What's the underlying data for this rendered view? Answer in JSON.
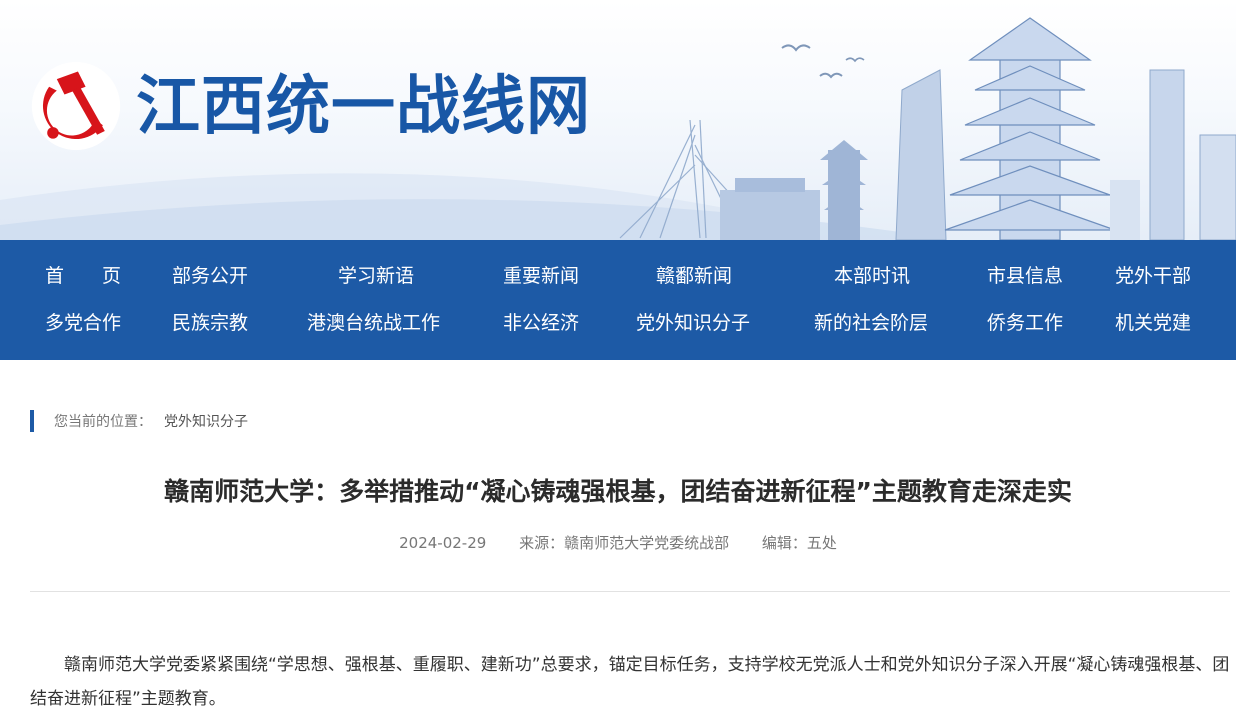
{
  "site": {
    "title": "江西统一战线网"
  },
  "nav": {
    "row1": [
      "首　　页",
      "部务公开",
      "学习新语",
      "重要新闻",
      "赣鄱新闻",
      "本部时讯",
      "市县信息",
      "党外干部"
    ],
    "row2": [
      "多党合作",
      "民族宗教",
      "港澳台统战工作",
      "非公经济",
      "党外知识分子",
      "新的社会阶层",
      "侨务工作",
      "机关党建"
    ]
  },
  "breadcrumb": {
    "prefix": "您当前的位置：",
    "current": "党外知识分子"
  },
  "article": {
    "title": "赣南师范大学：多举措推动“凝心铸魂强根基，团结奋进新征程”主题教育走深走实",
    "date": "2024-02-29",
    "source": "来源：赣南师范大学党委统战部",
    "editor": "编辑：五处",
    "paragraph": "赣南师范大学党委紧紧围绕“学思想、强根基、重履职、建新功”总要求，锚定目标任务，支持学校无党派人士和党外知识分子深入开展“凝心铸魂强根基、团结奋进新征程”主题教育。"
  },
  "colors": {
    "brand_blue": "#1d5aa6",
    "title_blue": "#1857a6",
    "party_red": "#d7141a"
  }
}
